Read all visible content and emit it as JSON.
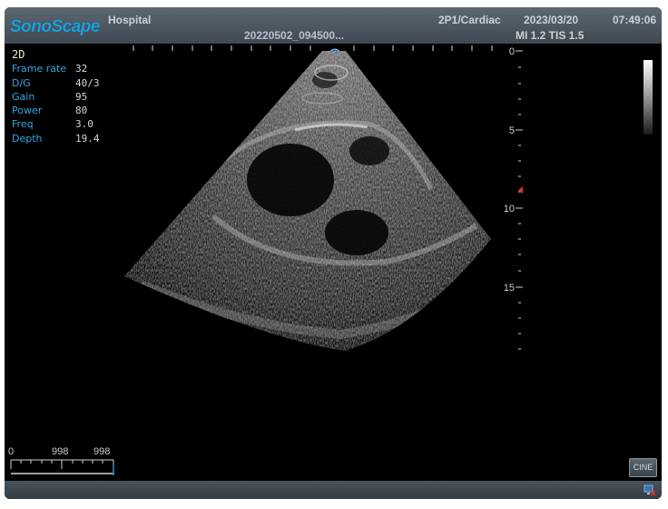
{
  "header": {
    "brand": "SonoScape",
    "institution": "Hospital",
    "patient_id": "20220502_094500...",
    "preset": "2P1/Cardiac",
    "date": "2023/03/20",
    "time": "07:49:06",
    "safety": "MI 1.2 TIS 1.5"
  },
  "imaging": {
    "mode": "2D",
    "params": [
      {
        "label": "Frame rate",
        "value": "32"
      },
      {
        "label": "D/G",
        "value": "40/3"
      },
      {
        "label": "Gain",
        "value": "95"
      },
      {
        "label": "Power",
        "value": "80"
      },
      {
        "label": "Freq",
        "value": "3.0"
      },
      {
        "label": "Depth",
        "value": "19.4"
      }
    ]
  },
  "depth_scale": {
    "labels": [
      "0",
      "5",
      "10",
      "15"
    ],
    "focus_depth_cm": 9
  },
  "cine_scale": {
    "start": "0",
    "mid": "998",
    "end": "998"
  },
  "controls": {
    "cine_label": "CINE"
  },
  "colors": {
    "accent_blue": "#36a7e0",
    "brand_blue": "#1e9fd8",
    "focus_marker": "#e0302a",
    "header_bg": "#4d5862"
  }
}
